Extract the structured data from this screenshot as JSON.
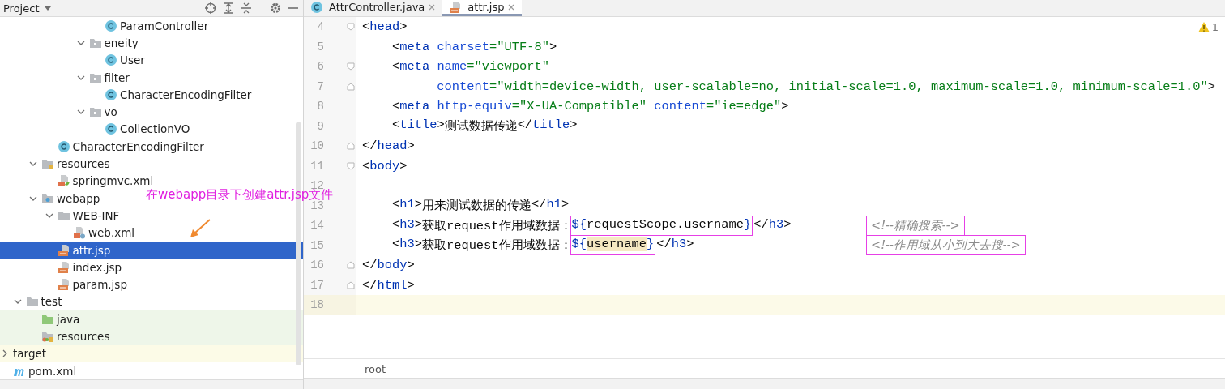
{
  "project_panel": {
    "title": "Project"
  },
  "tree": [
    {
      "children": [
        {
          "children": [
            {
              "children": [
                {
                  "children": [
                    {
                      "children": [
                        {
                          "children": [
                            {
                              "label": "ParamController",
                              "kind": "class",
                              "selected": false,
                              "test_source": false,
                              "excluded": false
                            }
                          ]
                        },
                        {
                          "label": "eneity",
                          "kind": "package",
                          "expanded": true,
                          "selected": false,
                          "test_source": false,
                          "excluded": false,
                          "children": [
                            {
                              "label": "User",
                              "kind": "class",
                              "selected": false,
                              "test_source": false,
                              "excluded": false
                            }
                          ]
                        },
                        {
                          "label": "filter",
                          "kind": "package",
                          "expanded": true,
                          "selected": false,
                          "test_source": false,
                          "excluded": false,
                          "children": [
                            {
                              "label": "CharacterEncodingFilter",
                              "kind": "class",
                              "selected": false,
                              "test_source": false,
                              "excluded": false
                            }
                          ]
                        },
                        {
                          "label": "vo",
                          "kind": "package",
                          "expanded": true,
                          "selected": false,
                          "test_source": false,
                          "excluded": false,
                          "children": [
                            {
                              "label": "CollectionVO",
                              "kind": "class",
                              "selected": false,
                              "test_source": false,
                              "excluded": false
                            }
                          ]
                        }
                      ]
                    }
                  ]
                },
                {
                  "label": "CharacterEncodingFilter",
                  "kind": "class",
                  "selected": false,
                  "test_source": false,
                  "excluded": false
                }
              ]
            },
            {
              "label": "resources",
              "kind": "resources",
              "expanded": true,
              "selected": false,
              "test_source": false,
              "excluded": false,
              "children": [
                {
                  "label": "springmvc.xml",
                  "kind": "spring-xml",
                  "selected": false,
                  "test_source": false,
                  "excluded": false
                }
              ]
            },
            {
              "label": "webapp",
              "kind": "web",
              "expanded": true,
              "selected": false,
              "test_source": false,
              "excluded": false,
              "children": [
                {
                  "label": "WEB-INF",
                  "kind": "folder",
                  "expanded": true,
                  "selected": false,
                  "test_source": false,
                  "excluded": false,
                  "children": [
                    {
                      "label": "web.xml",
                      "kind": "web-xml",
                      "selected": false,
                      "test_source": false,
                      "excluded": false
                    }
                  ]
                },
                {
                  "label": "attr.jsp",
                  "kind": "jsp",
                  "selected": true,
                  "test_source": false,
                  "excluded": false
                },
                {
                  "label": "index.jsp",
                  "kind": "jsp",
                  "selected": false,
                  "test_source": false,
                  "excluded": false
                },
                {
                  "label": "param.jsp",
                  "kind": "jsp",
                  "selected": false,
                  "test_source": false,
                  "excluded": false
                }
              ]
            }
          ]
        },
        {
          "label": "test",
          "kind": "folder",
          "expanded": true,
          "selected": false,
          "test_source": false,
          "excluded": false,
          "children": [
            {
              "label": "java",
              "kind": "test-folder",
              "selected": false,
              "test_source": true,
              "excluded": false
            },
            {
              "label": "resources",
              "kind": "test-resources",
              "selected": false,
              "test_source": true,
              "excluded": false
            }
          ]
        }
      ]
    },
    {
      "label": "target",
      "kind": "excluded-folder",
      "expanded": false,
      "selected": false,
      "test_source": false,
      "excluded": true
    },
    {
      "label": "pom.xml",
      "kind": "maven",
      "selected": false,
      "test_source": false,
      "excluded": false
    }
  ],
  "tabs": [
    {
      "label": "AttrController.java",
      "kind": "class",
      "selected": false
    },
    {
      "label": "attr.jsp",
      "kind": "jsp",
      "selected": true
    }
  ],
  "warnings": {
    "count": "1"
  },
  "lines": [
    {
      "number": "4",
      "fold_start": true,
      "fold_end": false,
      "current": false,
      "tokens": [
        {
          "kind": "p",
          "text": "<"
        },
        {
          "kind": "tag",
          "text": "head"
        },
        {
          "kind": "p",
          "text": ">"
        }
      ]
    },
    {
      "number": "5",
      "fold_start": false,
      "fold_end": false,
      "current": false,
      "tokens": [
        {
          "kind": "p",
          "text": "    <"
        },
        {
          "kind": "tag",
          "text": "meta"
        },
        {
          "kind": "attr",
          "text": " charset"
        },
        {
          "kind": "str",
          "text": "=\"UTF-8\""
        },
        {
          "kind": "p",
          "text": ">"
        }
      ]
    },
    {
      "number": "6",
      "fold_start": true,
      "fold_end": false,
      "current": false,
      "tokens": [
        {
          "kind": "p",
          "text": "    <"
        },
        {
          "kind": "tag",
          "text": "meta"
        },
        {
          "kind": "attr",
          "text": " name"
        },
        {
          "kind": "str",
          "text": "=\"viewport\""
        }
      ]
    },
    {
      "number": "7",
      "fold_start": false,
      "fold_end": true,
      "current": false,
      "tokens": [
        {
          "kind": "attr",
          "text": "          content"
        },
        {
          "kind": "str",
          "text": "=\"width=device-width, user-scalable=no, initial-scale=1.0, maximum-scale=1.0, minimum-scale=1.0\""
        },
        {
          "kind": "p",
          "text": ">"
        }
      ]
    },
    {
      "number": "8",
      "fold_start": false,
      "fold_end": false,
      "current": false,
      "tokens": [
        {
          "kind": "p",
          "text": "    <"
        },
        {
          "kind": "tag",
          "text": "meta"
        },
        {
          "kind": "attr",
          "text": " http-equiv"
        },
        {
          "kind": "str",
          "text": "=\"X-UA-Compatible\""
        },
        {
          "kind": "attr",
          "text": " content"
        },
        {
          "kind": "str",
          "text": "=\"ie=edge\""
        },
        {
          "kind": "p",
          "text": ">"
        }
      ]
    },
    {
      "number": "9",
      "fold_start": false,
      "fold_end": false,
      "current": false,
      "tokens": [
        {
          "kind": "p",
          "text": "    <"
        },
        {
          "kind": "tag",
          "text": "title"
        },
        {
          "kind": "p",
          "text": ">"
        },
        {
          "kind": "text",
          "text": "测试数据传递"
        },
        {
          "kind": "p",
          "text": "</"
        },
        {
          "kind": "tag",
          "text": "title"
        },
        {
          "kind": "p",
          "text": ">"
        }
      ]
    },
    {
      "number": "10",
      "fold_start": false,
      "fold_end": true,
      "current": false,
      "tokens": [
        {
          "kind": "p",
          "text": "</"
        },
        {
          "kind": "tag",
          "text": "head"
        },
        {
          "kind": "p",
          "text": ">"
        }
      ]
    },
    {
      "number": "11",
      "fold_start": true,
      "fold_end": false,
      "current": false,
      "tokens": [
        {
          "kind": "p",
          "text": "<"
        },
        {
          "kind": "tag",
          "text": "body"
        },
        {
          "kind": "p",
          "text": ">"
        }
      ]
    },
    {
      "number": "12",
      "fold_start": false,
      "fold_end": false,
      "current": false
    },
    {
      "number": "13",
      "fold_start": false,
      "fold_end": false,
      "current": false,
      "tokens": [
        {
          "kind": "p",
          "text": "    <"
        },
        {
          "kind": "tag",
          "text": "h1"
        },
        {
          "kind": "p",
          "text": ">"
        },
        {
          "kind": "text",
          "text": "用来测试数据的传递"
        },
        {
          "kind": "p",
          "text": "</"
        },
        {
          "kind": "tag",
          "text": "h1"
        },
        {
          "kind": "p",
          "text": ">"
        }
      ]
    },
    {
      "number": "14",
      "fold_start": false,
      "fold_end": false,
      "current": false,
      "tokens": [
        {
          "kind": "p",
          "text": "    <"
        },
        {
          "kind": "tag",
          "text": "h3"
        },
        {
          "kind": "p",
          "text": ">"
        },
        {
          "kind": "text",
          "text": "获取request作用域数据："
        },
        {
          "kind": "group",
          "boxed": true,
          "tokens": [
            {
              "kind": "el",
              "text": "${"
            },
            {
              "kind": "expr",
              "text": "requestScope.username",
              "highlight": false
            },
            {
              "kind": "el",
              "text": "}"
            }
          ]
        },
        {
          "kind": "p",
          "text": "</"
        },
        {
          "kind": "tag",
          "text": "h3"
        },
        {
          "kind": "p",
          "text": ">"
        }
      ],
      "comment": {
        "text": "<!--精确搜索-->",
        "boxed": true
      }
    },
    {
      "number": "15",
      "fold_start": false,
      "fold_end": false,
      "current": false,
      "tokens": [
        {
          "kind": "p",
          "text": "    <"
        },
        {
          "kind": "tag",
          "text": "h3"
        },
        {
          "kind": "p",
          "text": ">"
        },
        {
          "kind": "text",
          "text": "获取request作用域数据："
        },
        {
          "kind": "group",
          "boxed": true,
          "tokens": [
            {
              "kind": "el",
              "text": "${"
            },
            {
              "kind": "expr",
              "text": "username",
              "highlight": true
            },
            {
              "kind": "el",
              "text": "}"
            }
          ]
        },
        {
          "kind": "p",
          "text": "</"
        },
        {
          "kind": "tag",
          "text": "h3"
        },
        {
          "kind": "p",
          "text": ">"
        }
      ],
      "comment": {
        "text": "<!--作用域从小到大去搜-->",
        "boxed": true
      }
    },
    {
      "number": "16",
      "fold_start": false,
      "fold_end": true,
      "current": false,
      "tokens": [
        {
          "kind": "p",
          "text": "</"
        },
        {
          "kind": "tag",
          "text": "body"
        },
        {
          "kind": "p",
          "text": ">"
        }
      ]
    },
    {
      "number": "17",
      "fold_start": false,
      "fold_end": true,
      "current": false,
      "tokens": [
        {
          "kind": "p",
          "text": "</"
        },
        {
          "kind": "tag",
          "text": "html"
        },
        {
          "kind": "p",
          "text": ">"
        }
      ]
    },
    {
      "number": "18",
      "fold_start": false,
      "fold_end": false,
      "current": true
    }
  ],
  "breadcrumb": [
    "root"
  ],
  "annotation": {
    "text": "在webapp目录下创建attr.jsp文件"
  }
}
